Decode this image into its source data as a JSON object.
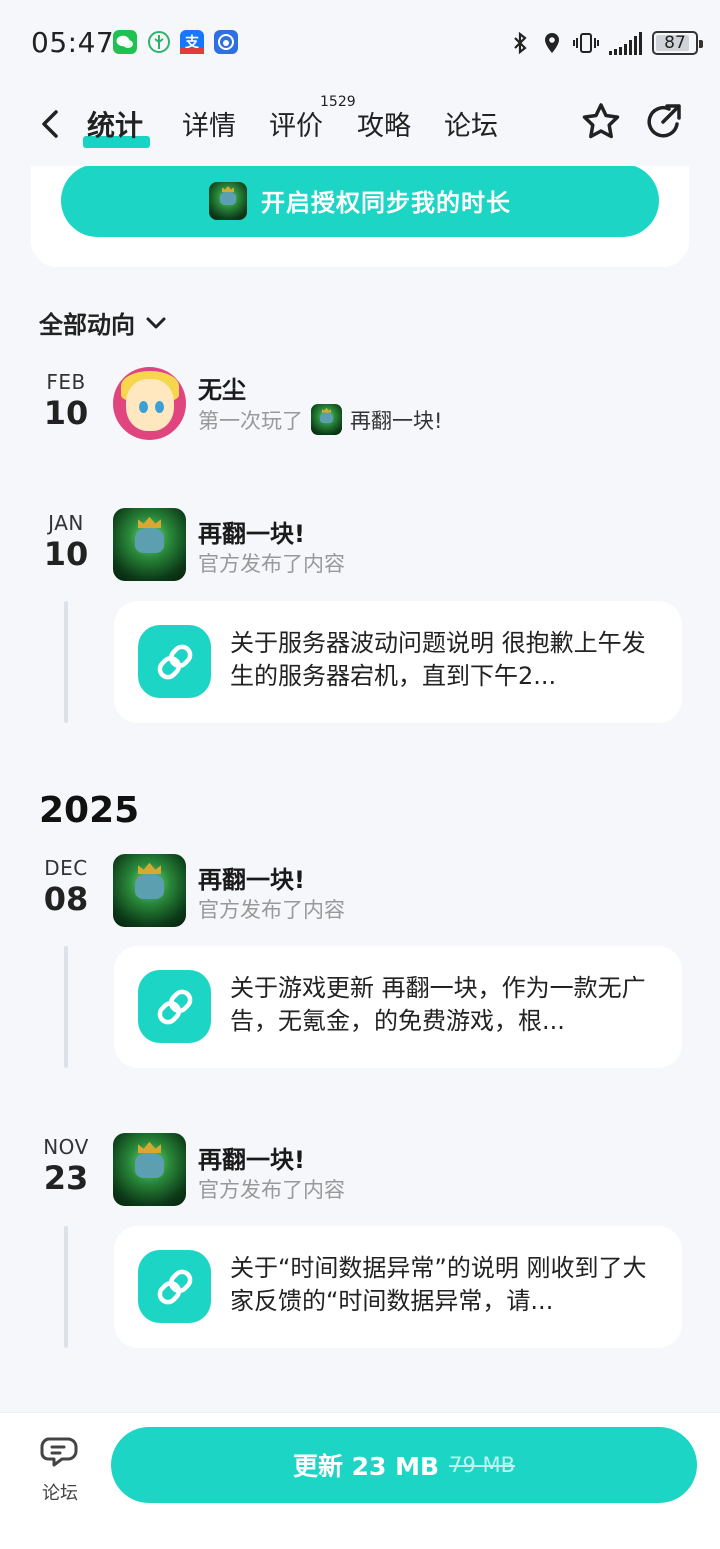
{
  "status_bar": {
    "time": "05:47",
    "battery": "87",
    "battery_level_percent": 87
  },
  "header": {
    "tabs": [
      {
        "label": "统计",
        "active": true
      },
      {
        "label": "详情"
      },
      {
        "label": "评价",
        "badge": "1529"
      },
      {
        "label": "攻略"
      },
      {
        "label": "论坛"
      }
    ],
    "icons": [
      "back-icon",
      "star-icon",
      "share-icon"
    ]
  },
  "auth": {
    "button_label": "开启授权同步我的时长"
  },
  "filter": {
    "label": "全部动向"
  },
  "timeline": [
    {
      "month": "FEB",
      "day": "10",
      "name": "无尘",
      "action": "第一次玩了",
      "game": "再翻一块!"
    },
    {
      "month": "JAN",
      "day": "10",
      "name": "再翻一块!",
      "action": "官方发布了内容",
      "post": "关于服务器波动问题说明 很抱歉上午发生的服务器宕机，直到下午2..."
    }
  ],
  "year_label": "2025",
  "timeline_2025": [
    {
      "month": "DEC",
      "day": "08",
      "name": "再翻一块!",
      "action": "官方发布了内容",
      "post": "关于游戏更新 再翻一块，作为一款无广告，无氪金，的免费游戏，根..."
    },
    {
      "month": "NOV",
      "day": "23",
      "name": "再翻一块!",
      "action": "官方发布了内容",
      "post": "关于“时间数据异常”的说明 刚收到了大家反馈的“时间数据异常，请..."
    }
  ],
  "bottom": {
    "forum_label": "论坛",
    "update_label": "更新 23 MB",
    "old_size": "79 MB"
  },
  "colors": {
    "accent": "#1dd5c5",
    "background": "#f5f7fa"
  }
}
